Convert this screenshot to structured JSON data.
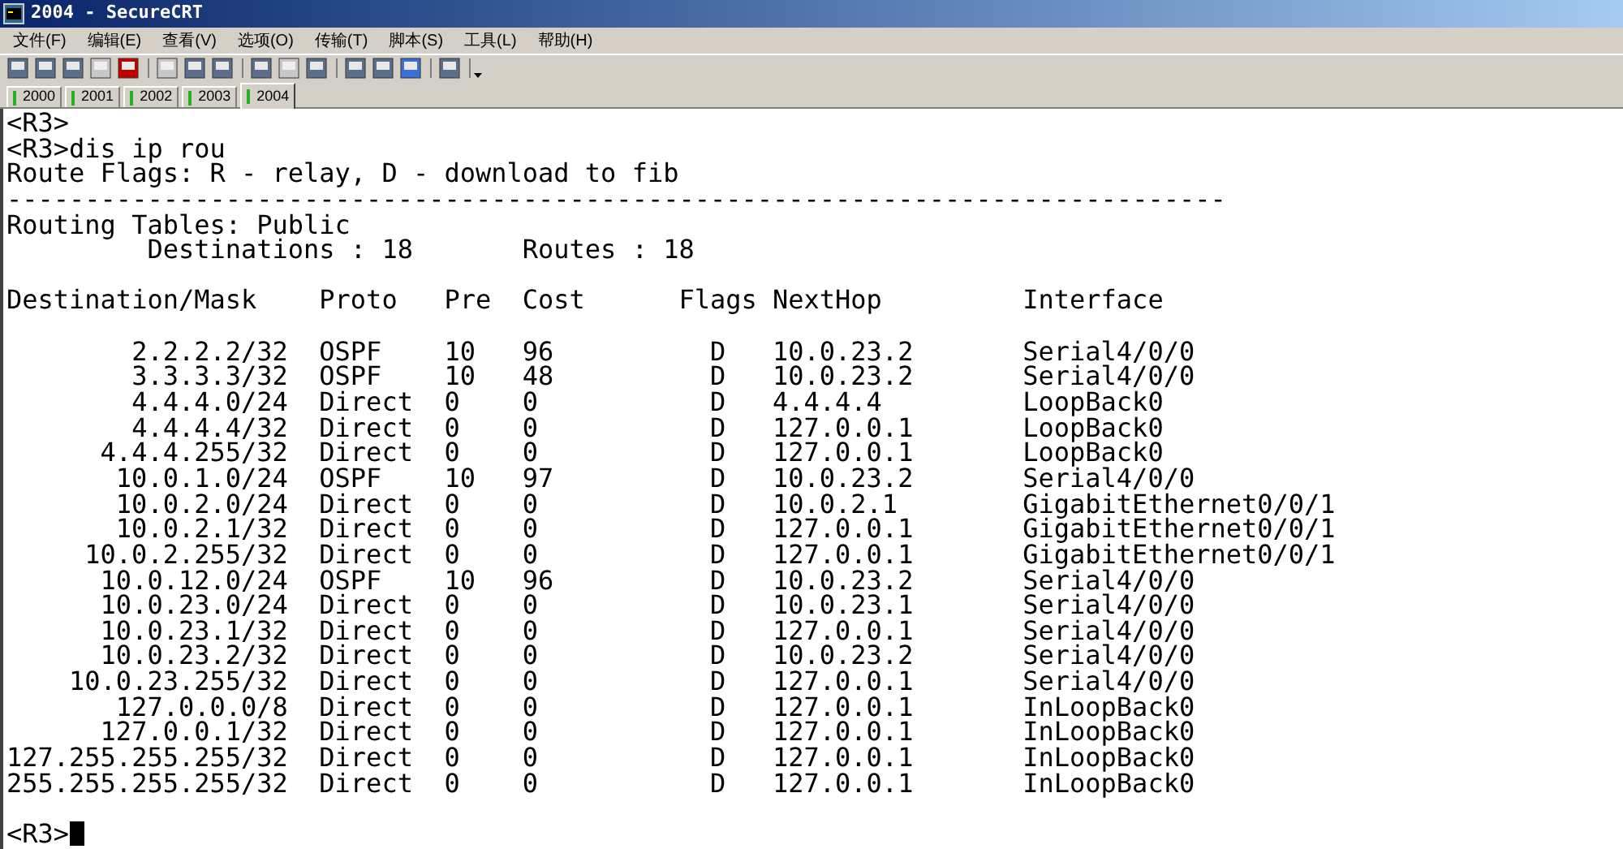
{
  "window": {
    "title": "2004 - SecureCRT"
  },
  "menu": [
    "文件(F)",
    "编辑(E)",
    "查看(V)",
    "选项(O)",
    "传输(T)",
    "脚本(S)",
    "工具(L)",
    "帮助(H)"
  ],
  "session_tabs": [
    {
      "label": "2000",
      "selected": false
    },
    {
      "label": "2001",
      "selected": false
    },
    {
      "label": "2002",
      "selected": false
    },
    {
      "label": "2003",
      "selected": false
    },
    {
      "label": "2004",
      "selected": true
    }
  ],
  "terminal": {
    "lines_before": [
      "<R3>",
      "<R3>dis ip rou",
      "Route Flags: R - relay, D - download to fib",
      "------------------------------------------------------------------------------",
      "Routing Tables: Public",
      "         Destinations : 18       Routes : 18"
    ],
    "table": {
      "columns": [
        "Destination/Mask",
        "Proto",
        "Pre",
        "Cost",
        "Flags",
        "NextHop",
        "Interface"
      ],
      "rows": [
        [
          "2.2.2.2/32",
          "OSPF",
          "10",
          "96",
          "D",
          "10.0.23.2",
          "Serial4/0/0"
        ],
        [
          "3.3.3.3/32",
          "OSPF",
          "10",
          "48",
          "D",
          "10.0.23.2",
          "Serial4/0/0"
        ],
        [
          "4.4.4.0/24",
          "Direct",
          "0",
          "0",
          "D",
          "4.4.4.4",
          "LoopBack0"
        ],
        [
          "4.4.4.4/32",
          "Direct",
          "0",
          "0",
          "D",
          "127.0.0.1",
          "LoopBack0"
        ],
        [
          "4.4.4.255/32",
          "Direct",
          "0",
          "0",
          "D",
          "127.0.0.1",
          "LoopBack0"
        ],
        [
          "10.0.1.0/24",
          "OSPF",
          "10",
          "97",
          "D",
          "10.0.23.2",
          "Serial4/0/0"
        ],
        [
          "10.0.2.0/24",
          "Direct",
          "0",
          "0",
          "D",
          "10.0.2.1",
          "GigabitEthernet0/0/1"
        ],
        [
          "10.0.2.1/32",
          "Direct",
          "0",
          "0",
          "D",
          "127.0.0.1",
          "GigabitEthernet0/0/1"
        ],
        [
          "10.0.2.255/32",
          "Direct",
          "0",
          "0",
          "D",
          "127.0.0.1",
          "GigabitEthernet0/0/1"
        ],
        [
          "10.0.12.0/24",
          "OSPF",
          "10",
          "96",
          "D",
          "10.0.23.2",
          "Serial4/0/0"
        ],
        [
          "10.0.23.0/24",
          "Direct",
          "0",
          "0",
          "D",
          "10.0.23.1",
          "Serial4/0/0"
        ],
        [
          "10.0.23.1/32",
          "Direct",
          "0",
          "0",
          "D",
          "127.0.0.1",
          "Serial4/0/0"
        ],
        [
          "10.0.23.2/32",
          "Direct",
          "0",
          "0",
          "D",
          "10.0.23.2",
          "Serial4/0/0"
        ],
        [
          "10.0.23.255/32",
          "Direct",
          "0",
          "0",
          "D",
          "127.0.0.1",
          "Serial4/0/0"
        ],
        [
          "127.0.0.0/8",
          "Direct",
          "0",
          "0",
          "D",
          "127.0.0.1",
          "InLoopBack0"
        ],
        [
          "127.0.0.1/32",
          "Direct",
          "0",
          "0",
          "D",
          "127.0.0.1",
          "InLoopBack0"
        ],
        [
          "127.255.255.255/32",
          "Direct",
          "0",
          "0",
          "D",
          "127.0.0.1",
          "InLoopBack0"
        ],
        [
          "255.255.255.255/32",
          "Direct",
          "0",
          "0",
          "D",
          "127.0.0.1",
          "InLoopBack0"
        ]
      ]
    },
    "prompt": "<R3>"
  }
}
